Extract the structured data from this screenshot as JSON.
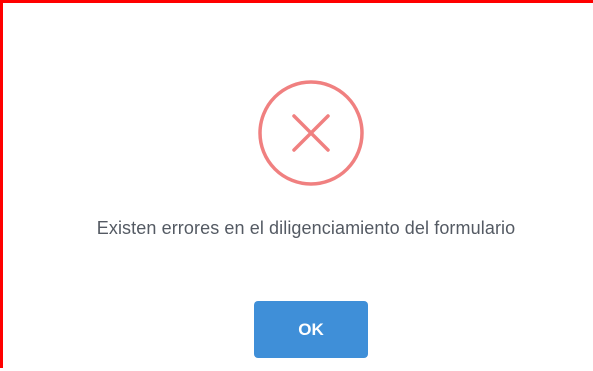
{
  "dialog": {
    "icon": "error-x-icon",
    "message": "Existen errores en el diligenciamiento del formulario",
    "ok_label": "OK"
  },
  "colors": {
    "frame_border": "#ff0000",
    "error_icon": "#f08080",
    "button_bg": "#3f8fd8",
    "message_text": "#545a63"
  }
}
